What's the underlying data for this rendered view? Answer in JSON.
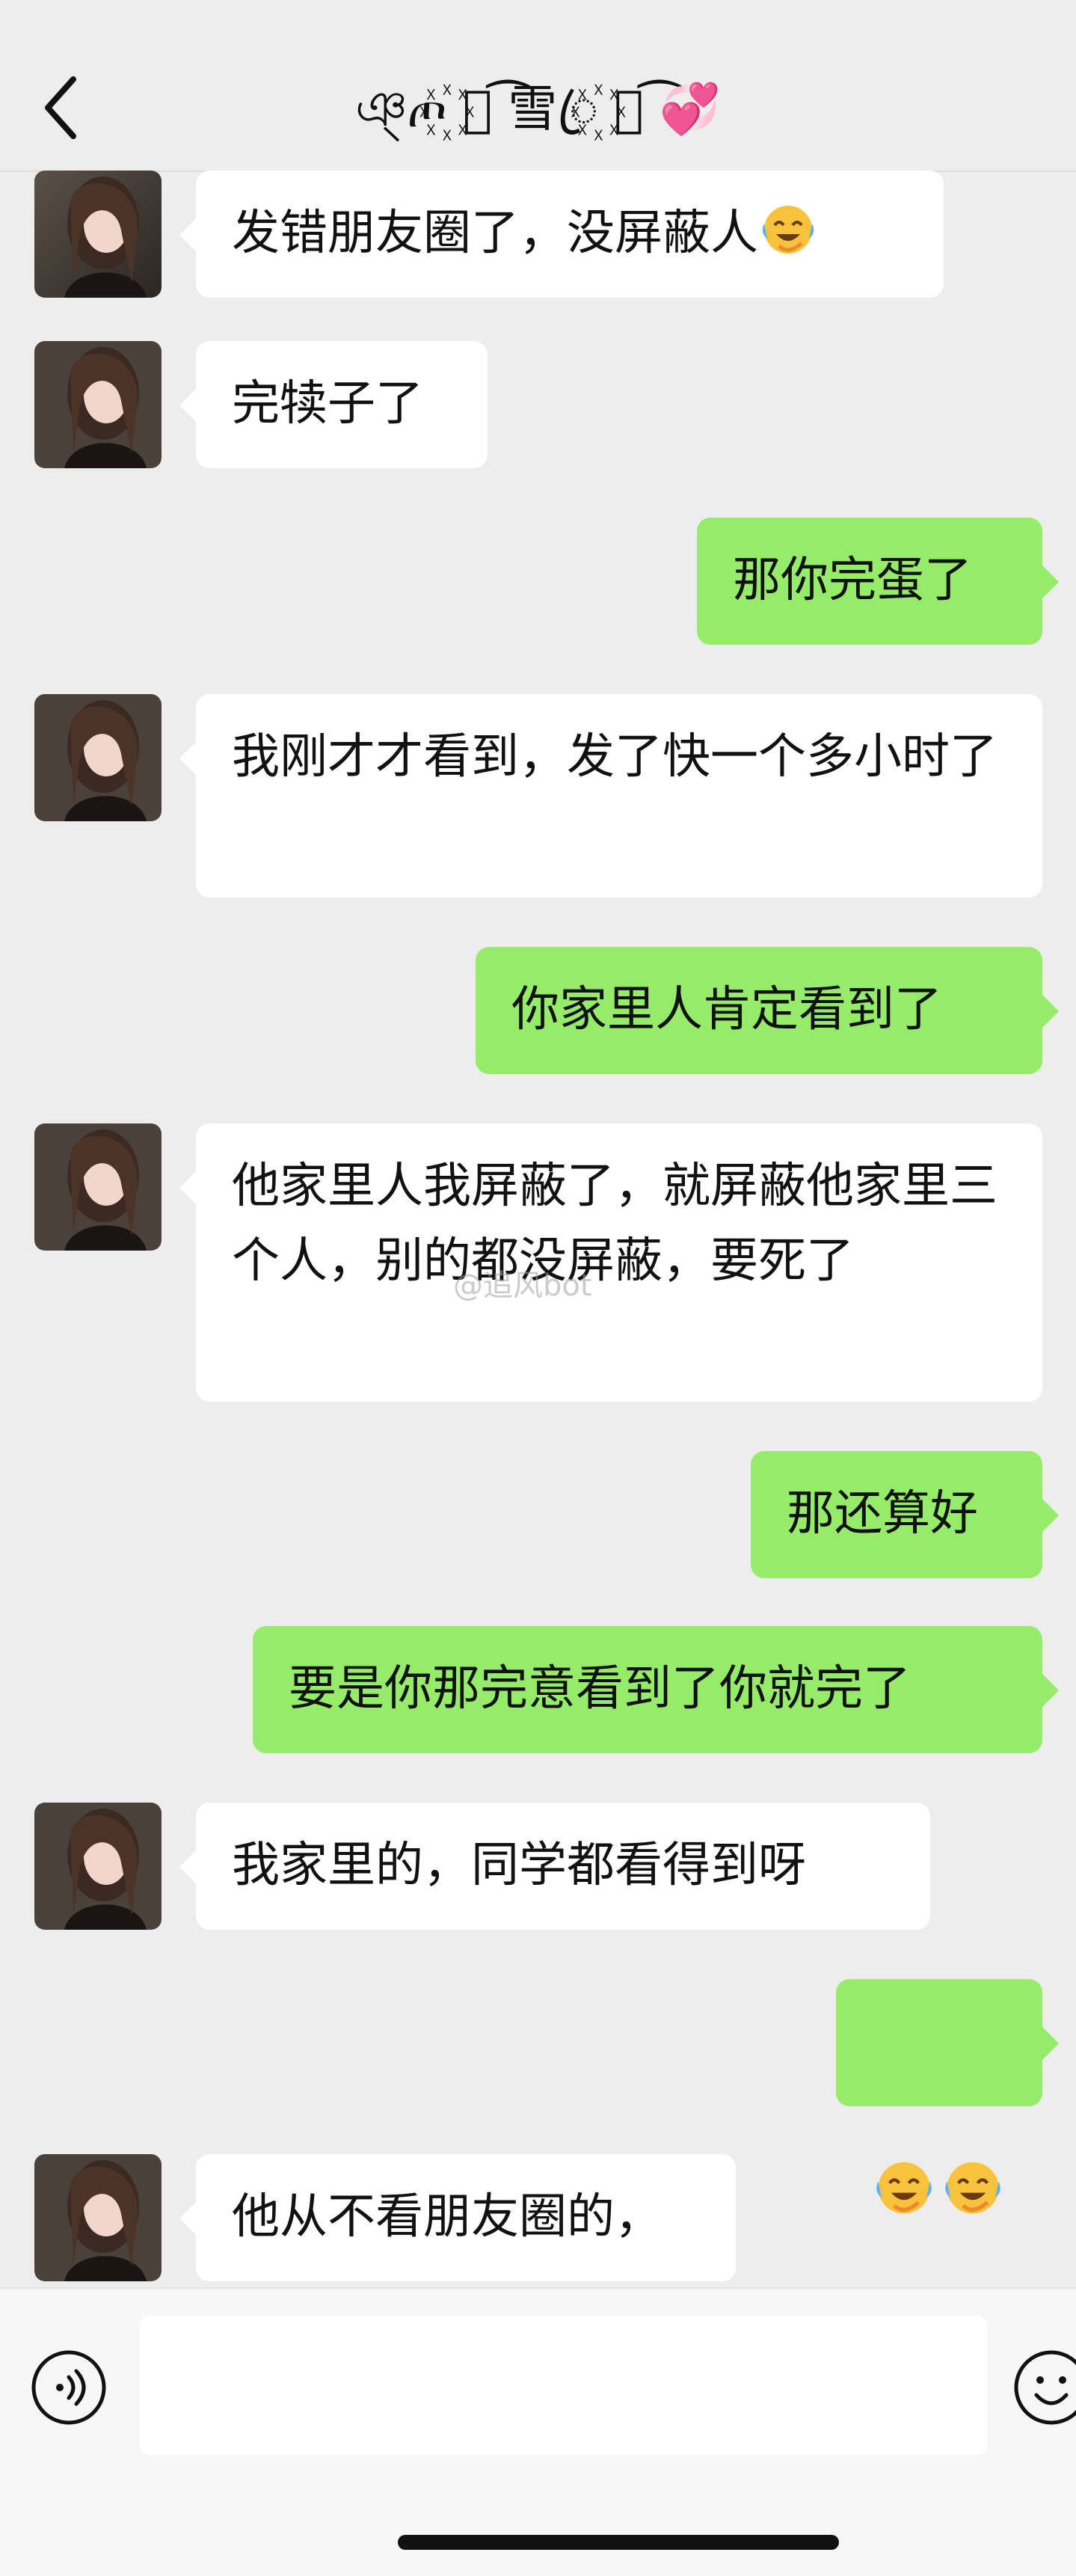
{
  "header": {
    "title": "ঞ্ጦ꙰ ⃕ ͡雪ꦿ꙰ ⃕ ͡💞",
    "back_icon": "chevron-left-icon"
  },
  "colors": {
    "background": "#ededed",
    "incoming_bubble": "#ffffff",
    "outgoing_bubble": "#95ec69",
    "text": "#111111"
  },
  "messages": [
    {
      "side": "left",
      "text": "发错朋友圈了，没屏蔽人",
      "emoji": "face-with-tears-of-joy"
    },
    {
      "side": "left",
      "text": "完犊子了"
    },
    {
      "side": "right",
      "text": "那你完蛋了"
    },
    {
      "side": "left",
      "text": "我刚才才看到，发了快一个多小时了"
    },
    {
      "side": "right",
      "text": "你家里人肯定看到了"
    },
    {
      "side": "left",
      "text": "他家里人我屏蔽了，就屏蔽他家里三个人，别的都没屏蔽，要死了"
    },
    {
      "side": "right",
      "text": "那还算好"
    },
    {
      "side": "right",
      "text": "要是你那完意看到了你就完了"
    },
    {
      "side": "left",
      "text": "我家里的，同学都看得到呀"
    },
    {
      "side": "right",
      "text": "",
      "emoji_count": 2,
      "emoji": "face-with-tears-of-joy"
    },
    {
      "side": "left",
      "text": "他从不看朋友圈的，"
    }
  ],
  "watermark": "@追风bot",
  "input": {
    "value": "",
    "voice_icon": "voice-icon",
    "emoji_icon": "smiley-icon"
  }
}
